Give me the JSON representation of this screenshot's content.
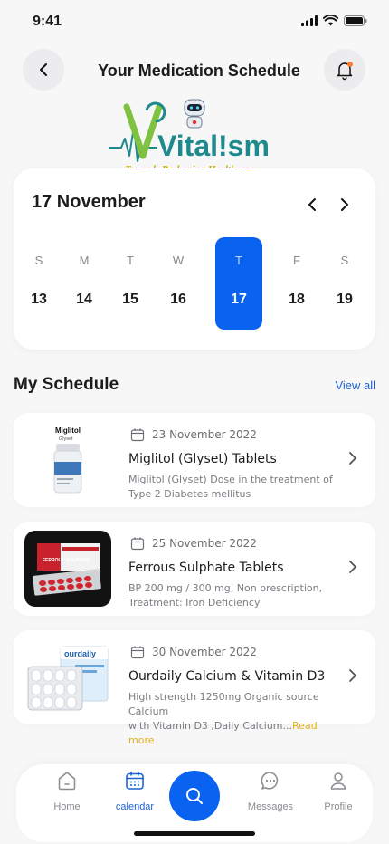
{
  "status": {
    "time": "9:41"
  },
  "header": {
    "title": "Your Medication Schedule"
  },
  "logo": {
    "wordmark": "Vital!sm",
    "tagline": "Towards Reshaping Healthcare"
  },
  "calendar": {
    "month_label": "17 November",
    "days": [
      {
        "letter": "S",
        "num": "13",
        "selected": false
      },
      {
        "letter": "M",
        "num": "14",
        "selected": false
      },
      {
        "letter": "T",
        "num": "15",
        "selected": false
      },
      {
        "letter": "W",
        "num": "16",
        "selected": false
      },
      {
        "letter": "T",
        "num": "17",
        "selected": true
      },
      {
        "letter": "F",
        "num": "18",
        "selected": false
      },
      {
        "letter": "S",
        "num": "19",
        "selected": false
      }
    ]
  },
  "schedule": {
    "title": "My Schedule",
    "view_all": "View all",
    "items": [
      {
        "date": "23 November 2022",
        "name": "Miglitol (Glyset) Tablets",
        "desc_line1": "Miglitol (Glyset) Dose in the treatment of",
        "desc_line2": "Type 2 Diabetes mellitus",
        "read_more": "",
        "pack_label": "Miglitol",
        "pack_sub": "Glyset"
      },
      {
        "date": "25 November 2022",
        "name": "Ferrous Sulphate Tablets",
        "desc_line1": "BP 200 mg / 300 mg, Non prescription,",
        "desc_line2": "Treatment: Iron Deficiency",
        "read_more": "",
        "pack_label": "FERROUS SULPHATE"
      },
      {
        "date": "30 November 2022",
        "name": "Ourdaily Calcium & Vitamin D3",
        "desc_line1": "High strength 1250mg Organic source Calcium",
        "desc_line2": "with Vitamin D3 ,Daily Calcium...",
        "read_more": "Read more",
        "pack_label": "ourdaily"
      }
    ]
  },
  "nav": {
    "home": "Home",
    "calendar": "calendar",
    "messages": "Messages",
    "profile": "Profile"
  },
  "colors": {
    "accent": "#0a62f0",
    "link": "#1d63d8",
    "read_more": "#e3b21a",
    "notification_dot": "#ff7a2f"
  }
}
